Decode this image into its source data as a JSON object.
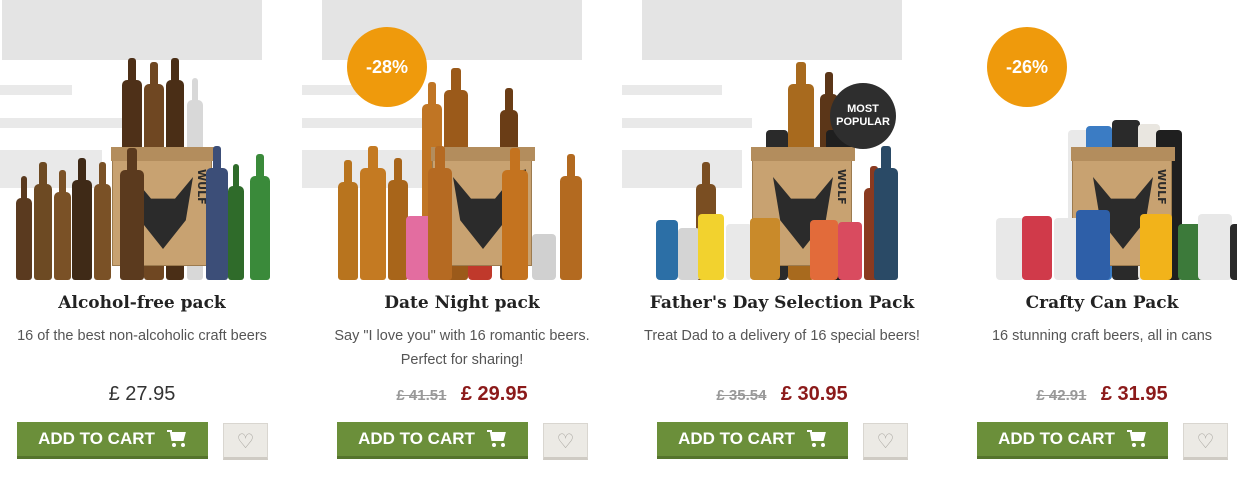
{
  "products": [
    {
      "title": "Alcohol-free pack",
      "description": "16 of the best non-alcoholic craft beers",
      "price": "£ 27.95",
      "old_price": null,
      "new_price": null,
      "badge": null,
      "popular": null,
      "add_to_cart": "ADD TO CART",
      "wishlist_icon": "heart-icon",
      "cart_icon": "cart-icon"
    },
    {
      "title": "Date Night pack",
      "description": "Say \"I love you\" with 16 romantic beers. Perfect for sharing!",
      "price": null,
      "old_price": "£ 41.51",
      "new_price": "£ 29.95",
      "badge": "-28%",
      "popular": null,
      "add_to_cart": "ADD TO CART",
      "wishlist_icon": "heart-icon",
      "cart_icon": "cart-icon"
    },
    {
      "title": "Father's Day Selection Pack",
      "description": "Treat Dad to a delivery of 16 special beers!",
      "price": null,
      "old_price": "£ 35.54",
      "new_price": "£ 30.95",
      "badge": null,
      "popular": "MOST POPULAR",
      "add_to_cart": "ADD TO CART",
      "wishlist_icon": "heart-icon",
      "cart_icon": "cart-icon"
    },
    {
      "title": "Crafty Can Pack",
      "description": "16 stunning craft beers, all in cans",
      "price": null,
      "old_price": "£ 42.91",
      "new_price": "£ 31.95",
      "badge": "-26%",
      "popular": null,
      "add_to_cart": "ADD TO CART",
      "wishlist_icon": "heart-icon",
      "cart_icon": "cart-icon"
    }
  ],
  "box_brand": "WULF",
  "colors": {
    "cart_button": "#6b8f3a",
    "sale_price": "#8b1a1a",
    "badge": "#ef9a0c",
    "popular_badge": "#2e2e2e"
  }
}
